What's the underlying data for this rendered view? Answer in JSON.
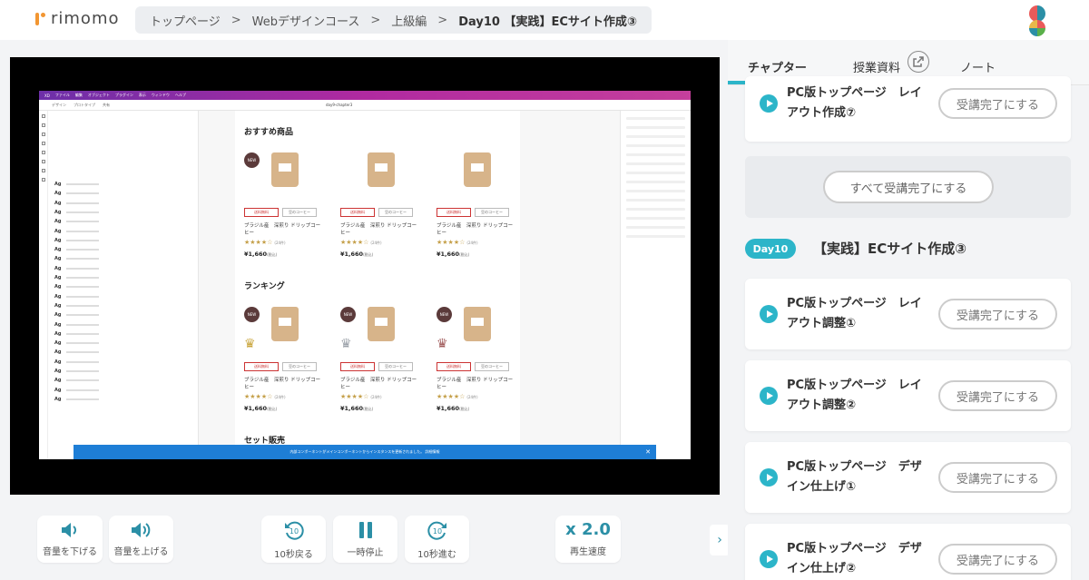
{
  "header": {
    "logo_text": "rimomo",
    "breadcrumb": [
      "トップページ",
      "Webデザインコース",
      "上級編",
      "Day10 【実践】ECサイト作成③"
    ],
    "separator": ">"
  },
  "video": {
    "xd_menu": [
      "XD",
      "ファイル",
      "編集",
      "オブジェクト",
      "プラグイン",
      "表示",
      "ウィンドウ",
      "ヘルプ"
    ],
    "xd_modes": [
      "デザイン",
      "プロトタイプ",
      "共有"
    ],
    "xd_doc_title": "day9-chapter3",
    "artboard": {
      "recommended_title": "おすすめ商品",
      "ranking_title": "ランキング",
      "set_title": "セット販売",
      "product_name": "ブラジル産　深煎り ドリップコーヒー",
      "tag_free": "送料無料",
      "tag_bean": "豆のコーヒー",
      "stars": "★★★★☆",
      "review_count": "(24件)",
      "price": "¥1,660",
      "price_note": "(税込)",
      "new_label": "NEW",
      "notice": "内部コンポーネントがメインコンポーネントからインスタンスを更新されました。 詳細情報"
    }
  },
  "controls": {
    "volume_down": "音量を下げる",
    "volume_up": "音量を上げる",
    "back10": "10秒戻る",
    "pause": "一時停止",
    "forward10": "10秒進む",
    "speed_value": "x 2.0",
    "speed_label": "再生速度",
    "icon_names": [
      "volume-down-icon",
      "volume-up-icon",
      "rewind-10-icon",
      "pause-icon",
      "forward-10-icon",
      "chevron-right-icon"
    ]
  },
  "panel": {
    "tabs": [
      "チャプター",
      "授業資料",
      "ノート"
    ],
    "prev_chapter": {
      "title": "PC版トップページ　レイアウト作成⑦",
      "button": "受講完了にする"
    },
    "complete_all": "すべて受講完了にする",
    "day_badge": "Day10",
    "day_title": "【実践】ECサイト作成③",
    "chapters": [
      {
        "title": "PC版トップページ　レイアウト調整①",
        "button": "受講完了にする"
      },
      {
        "title": "PC版トップページ　レイアウト調整②",
        "button": "受講完了にする"
      },
      {
        "title": "PC版トップページ　デザイン仕上げ①",
        "button": "受講完了にする"
      },
      {
        "title": "PC版トップページ　デザイン仕上げ②",
        "button": "受講完了にする"
      }
    ]
  },
  "colors": {
    "accent": "#2cb5c9",
    "icon": "#2b8fa6",
    "logo": "#f29632"
  }
}
